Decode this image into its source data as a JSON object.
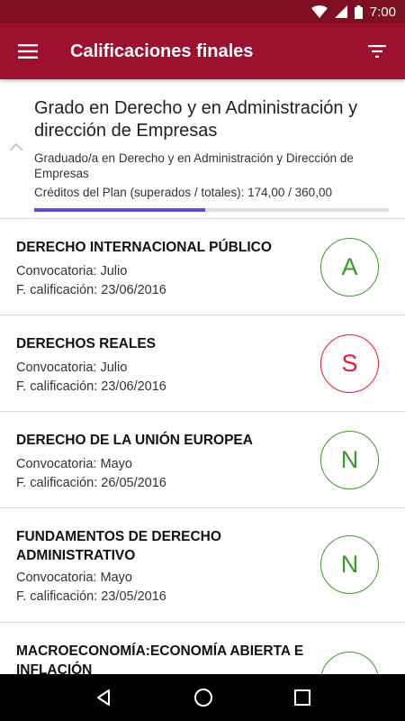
{
  "status_bar": {
    "time": "7:00"
  },
  "app_bar": {
    "title": "Calificaciones finales",
    "menu_icon": "hamburger-menu-icon",
    "filter_icon": "filter-icon"
  },
  "header": {
    "degree_title": "Grado en Derecho y en Administración y dirección de Empresas",
    "plan_name": "Graduado/a en Derecho y en Administración y Dirección de Empresas",
    "credits_text": "Créditos del Plan (superados / totales): 174,00 / 360,00",
    "credits_progress": 0.483
  },
  "colors": {
    "app_bar": "#9e1030",
    "status_bar": "#7e0f22",
    "pass_green": "#3a9d23",
    "fail_red": "#e8192c",
    "progress": "#5b4fd6"
  },
  "subjects": [
    {
      "name": "DERECHO INTERNACIONAL PÚBLICO",
      "convocatoria": "Convocatoria: Julio",
      "fecha": "F. calificación: 23/06/2016",
      "grade": "A",
      "grade_color": "#3a9d23"
    },
    {
      "name": "DERECHOS REALES",
      "convocatoria": "Convocatoria: Julio",
      "fecha": "F. calificación: 23/06/2016",
      "grade": "S",
      "grade_color": "#e8192c"
    },
    {
      "name": "DERECHO DE LA UNIÓN EUROPEA",
      "convocatoria": "Convocatoria: Mayo",
      "fecha": "F. calificación: 26/05/2016",
      "grade": "N",
      "grade_color": "#3a9d23"
    },
    {
      "name": "FUNDAMENTOS DE DERECHO ADMINISTRATIVO",
      "convocatoria": "Convocatoria: Mayo",
      "fecha": "F. calificación: 23/05/2016",
      "grade": "N",
      "grade_color": "#3a9d23"
    },
    {
      "name": "MACROECONOMÍA:ECONOMÍA ABIERTA E INFLACIÓN",
      "grade": "",
      "grade_color": "#3a9d23"
    }
  ]
}
